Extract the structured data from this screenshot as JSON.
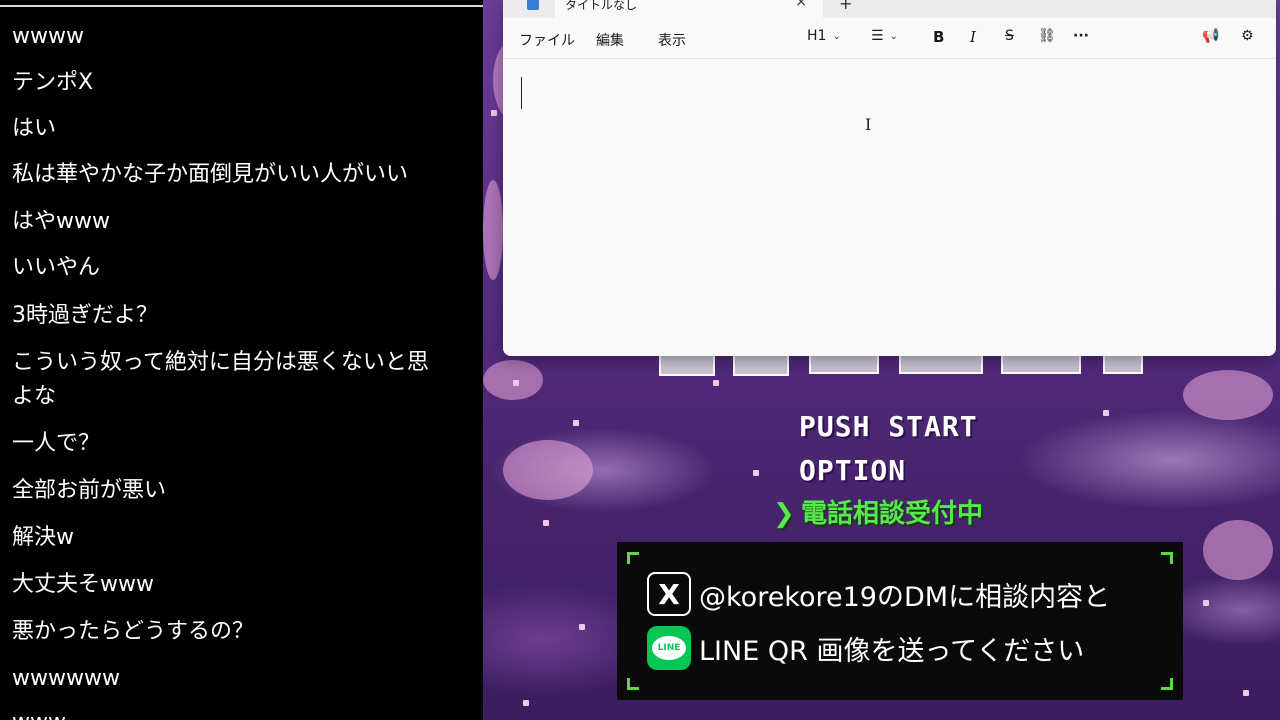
{
  "chat": {
    "messages": [
      {
        "text": "wwww"
      },
      {
        "text": "テンポX"
      },
      {
        "text": "はい"
      },
      {
        "text": "私は華やかな子か面倒見がいい人がいい"
      },
      {
        "text": "はやwww"
      },
      {
        "text": "いいやん"
      },
      {
        "text": "3時過ぎだよ？"
      },
      {
        "text": "こういう奴って絶対に自分は悪くないと思\nよな"
      },
      {
        "text": "一人で？"
      },
      {
        "text": "全部お前が悪い"
      },
      {
        "text": "解決w"
      },
      {
        "text": "大丈夫そwww"
      },
      {
        "text": "悪かったらどうするの？"
      },
      {
        "text": "wwwwww"
      },
      {
        "text": "www"
      }
    ]
  },
  "notepad": {
    "tab_title": "タイトルなし",
    "close_glyph": "×",
    "new_tab_glyph": "+",
    "menus": {
      "file": "ファイル",
      "edit": "編集",
      "view": "表示"
    },
    "toolbar": {
      "heading": "H1",
      "list_glyph": "☰",
      "bold": "B",
      "italic": "I",
      "strike": "S",
      "link_glyph": "⛓",
      "more": "···",
      "announce_glyph": "📢",
      "settings_glyph": "⚙",
      "chevron": "⌄"
    },
    "editor_text": ""
  },
  "stream": {
    "menu": {
      "push_start": "PUSH START",
      "option": "OPTION"
    },
    "consult": {
      "arrow": "❯",
      "text": "電話相談受付中"
    },
    "info": {
      "x_logo": "X",
      "x_line": "@korekore19のDMに相談内容と",
      "line_logo": "LINE",
      "line_line": "LINE QR 画像を送ってください"
    },
    "colors": {
      "accent_green": "#57e84d",
      "line_green": "#06c755",
      "sky_purple": "#5a2f86"
    }
  }
}
